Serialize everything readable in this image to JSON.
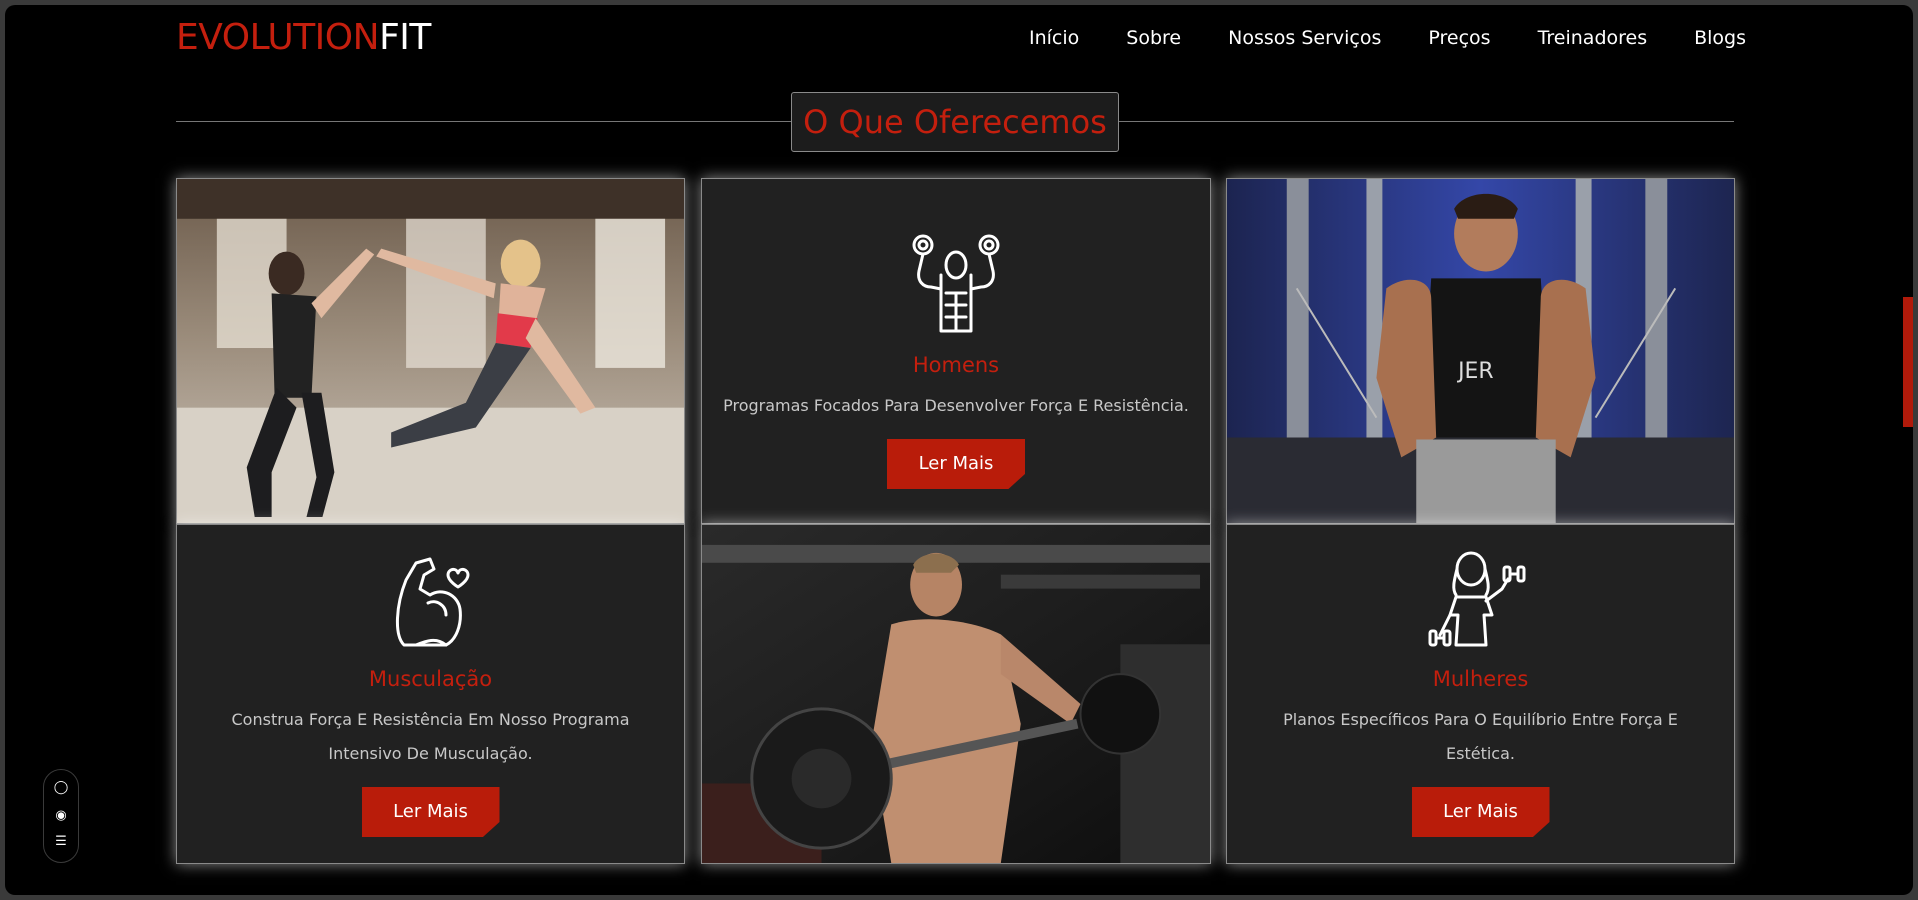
{
  "header": {
    "logo_part1": "EVOLUTION",
    "logo_part2": "FIT",
    "nav": [
      "Início",
      "Sobre",
      "Nossos Serviços",
      "Preços",
      "Treinadores",
      "Blogs"
    ]
  },
  "section": {
    "title": "O Que Oferecemos"
  },
  "cards": {
    "homens": {
      "icon": "muscle-man-dumbbells-icon",
      "title": "Homens",
      "description": "Programas Focados Para Desenvolver Força E Resistência.",
      "button": "Ler Mais"
    },
    "musculacao": {
      "icon": "flexed-arm-heart-icon",
      "title": "Musculação",
      "description": "Construa Força E Resistência Em Nosso Programa Intensivo De Musculação.",
      "button": "Ler Mais"
    },
    "mulheres": {
      "icon": "woman-dumbbell-icon",
      "title": "Mulheres",
      "description": "Planos Específicos Para O Equilíbrio Entre Força E Estética.",
      "button": "Ler Mais"
    }
  },
  "photos": {
    "top_left": "two-women-high-five-photo",
    "bottom_middle": "man-barbell-curl-photo",
    "top_right": "man-cable-machine-photo"
  },
  "colors": {
    "accent": "#c41f0e",
    "card_bg": "#212121",
    "page_bg": "#000000"
  },
  "side_widget": [
    "chat-icon",
    "eye-icon",
    "settings-icon"
  ]
}
